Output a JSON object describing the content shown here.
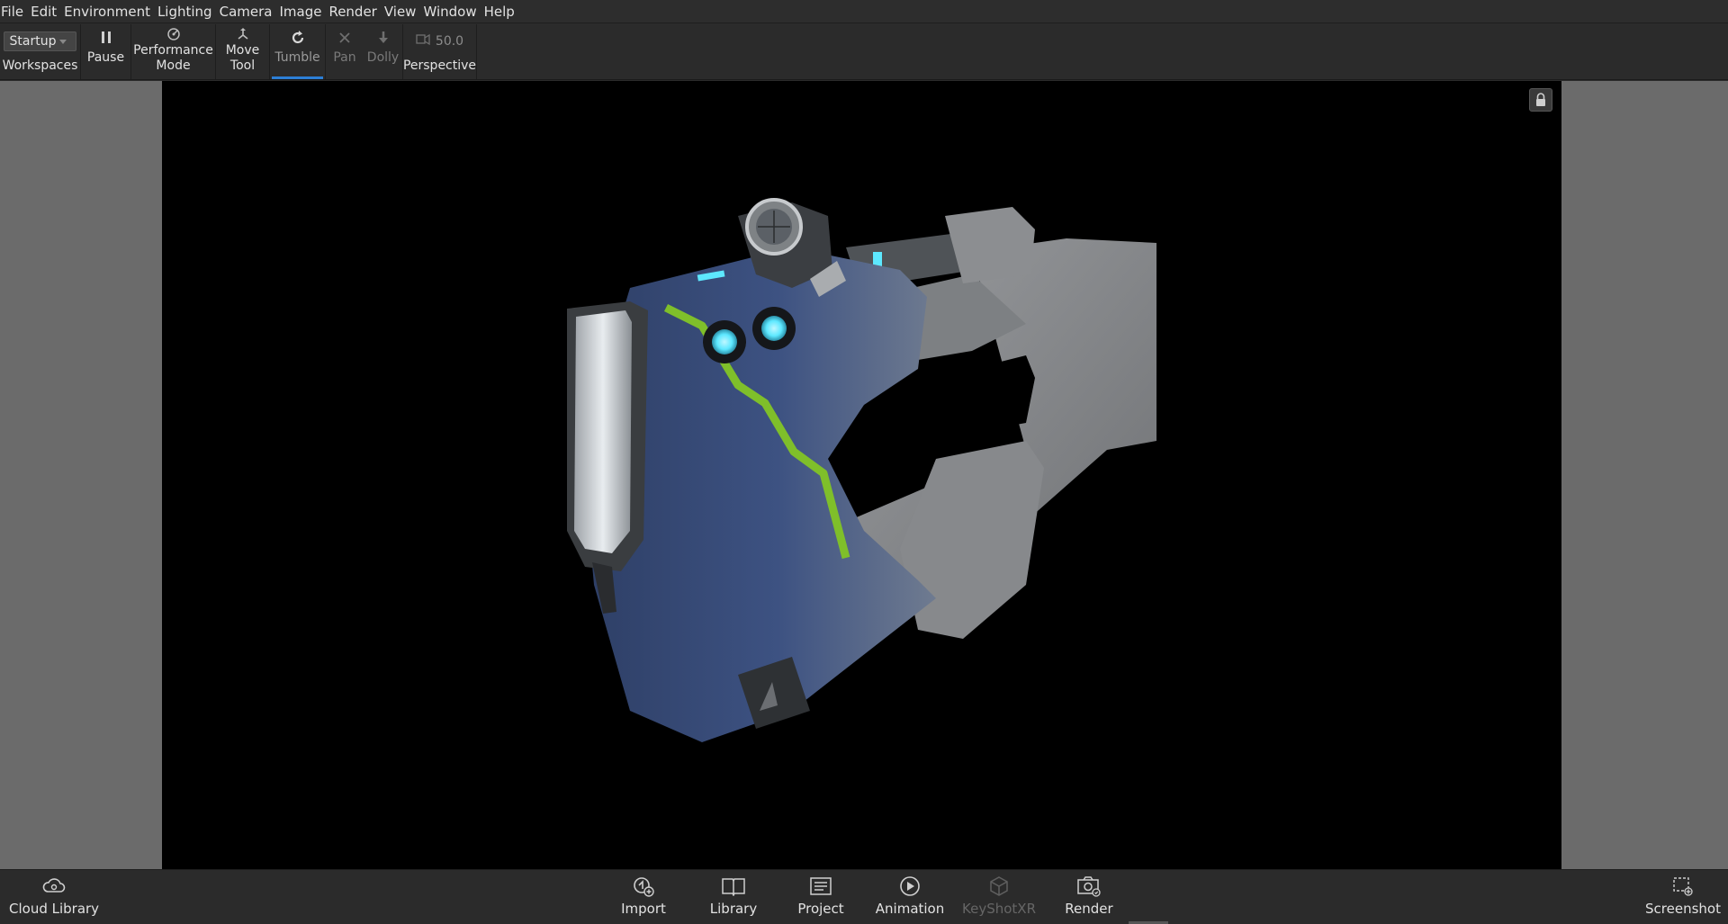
{
  "menu": [
    "File",
    "Edit",
    "Environment",
    "Lighting",
    "Camera",
    "Image",
    "Render",
    "View",
    "Window",
    "Help"
  ],
  "toolbar": {
    "workspace_value": "Startup",
    "workspaces_label": "Workspaces",
    "pause_label": "Pause",
    "performance_label_1": "Performance",
    "performance_label_2": "Mode",
    "move_label_1": "Move",
    "move_label_2": "Tool",
    "tumble_label": "Tumble",
    "pan_label": "Pan",
    "dolly_label": "Dolly",
    "fov_value": "50.0",
    "perspective_label": "Perspective"
  },
  "bottom": {
    "cloud_library_label": "Cloud Library",
    "import_label": "Import",
    "library_label": "Library",
    "project_label": "Project",
    "animation_label": "Animation",
    "keyshotxr_label": "KeyShotXR",
    "render_label": "Render",
    "screenshot_label": "Screenshot"
  },
  "colors": {
    "accent": "#2c7fd6",
    "model_blue": "#3b4f7c",
    "model_grey": "#8f9194",
    "glow_cyan": "#5de8ff",
    "stripe_green": "#7fbf2a"
  }
}
